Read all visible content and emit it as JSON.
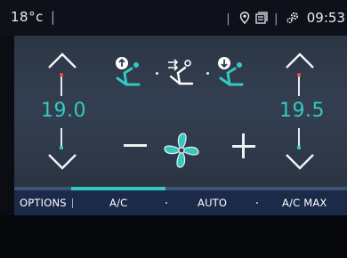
{
  "status": {
    "outside_temp": "18°c",
    "clock": "09:53",
    "icons": [
      "location-pin-icon",
      "notifications-icon",
      "settings-icon"
    ]
  },
  "climate": {
    "driver_temp": "19.0",
    "passenger_temp": "19.5",
    "modes": [
      "airflow-upper-icon",
      "airflow-feet-face-icon",
      "airflow-lower-icon"
    ],
    "fan_controls": [
      "minus",
      "fan-icon",
      "plus"
    ],
    "accent_color": "#34c9bf"
  },
  "bottom": {
    "options": "OPTIONS",
    "ac": "A/C",
    "auto": "AUTO",
    "ac_max": "A/C MAX",
    "active_item": "A/C"
  }
}
